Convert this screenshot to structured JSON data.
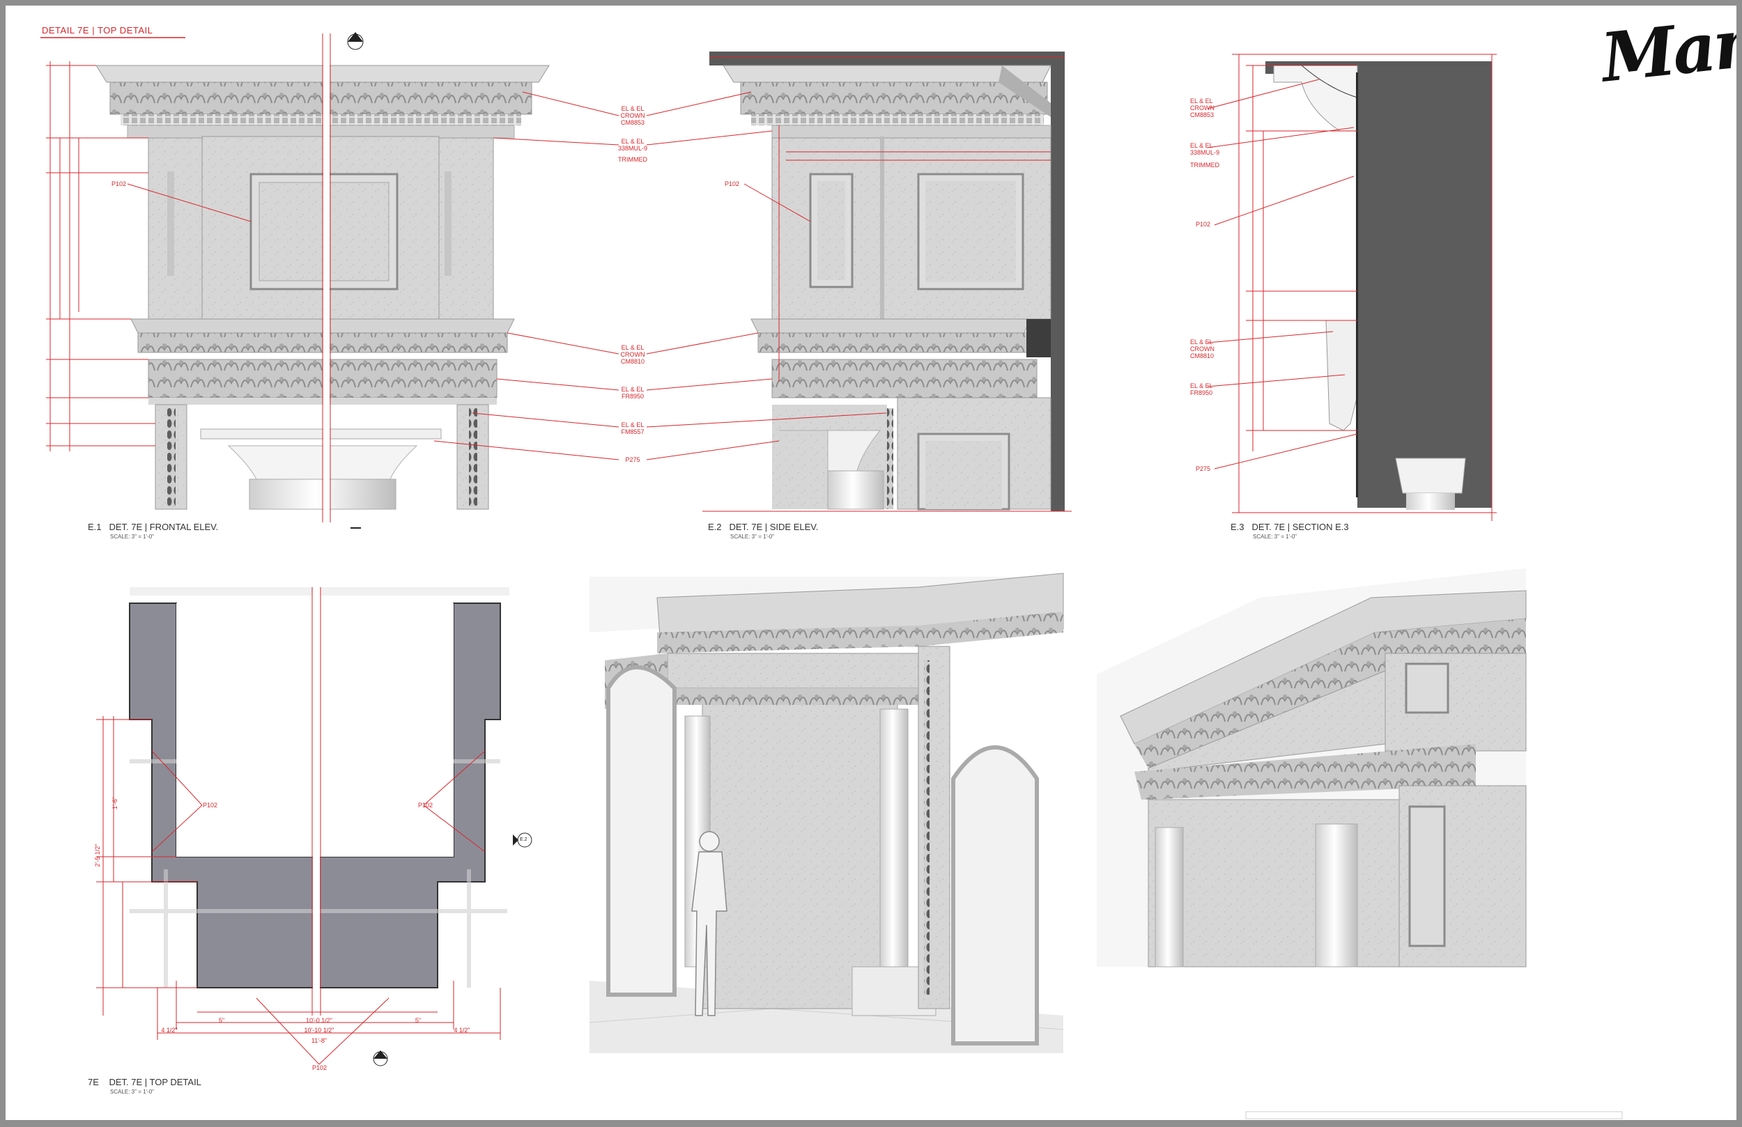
{
  "brand": {
    "logo_text": "Mank"
  },
  "sheet_header": {
    "text": "DETAIL 7E | TOP DETAIL"
  },
  "views": [
    {
      "num": "E.1",
      "title": "DET. 7E | FRONTAL ELEV.",
      "scale": "SCALE: 3\" = 1'-0\""
    },
    {
      "num": "E.2",
      "title": "DET. 7E | SIDE ELEV.",
      "scale": "SCALE: 3\" = 1'-0\""
    },
    {
      "num": "E.3",
      "title": "DET. 7E | SECTION E.3",
      "scale": "SCALE: 3\" = 1'-0\""
    },
    {
      "num": "7E",
      "title": "DET. 7E | TOP DETAIL",
      "scale": "SCALE: 3\" = 1'-0\""
    }
  ],
  "callouts_e1e2": [
    {
      "lines": [
        "EL & EL",
        "CROWN",
        "CM8853"
      ]
    },
    {
      "lines": [
        "EL & EL",
        "338MUL-9"
      ]
    },
    {
      "lines": [
        "TRIMMED"
      ]
    },
    {
      "lines": [
        "EL & EL",
        "CROWN",
        "CM8810"
      ]
    },
    {
      "lines": [
        "EL & EL",
        "FR8950"
      ]
    },
    {
      "lines": [
        "EL & EL",
        "FM8557"
      ]
    },
    {
      "lines": [
        "P275"
      ]
    }
  ],
  "material_tag": "P102",
  "callouts_e3": [
    {
      "lines": [
        "EL & EL",
        "CROWN",
        "CM8853"
      ]
    },
    {
      "lines": [
        "EL & EL",
        "338MUL-9"
      ]
    },
    {
      "lines": [
        "TRIMMED"
      ]
    },
    {
      "lines": [
        "P102"
      ]
    },
    {
      "lines": [
        "EL & EL",
        "CROWN",
        "CM8810"
      ]
    },
    {
      "lines": [
        "EL & EL",
        "FR8950"
      ]
    },
    {
      "lines": [
        "P275"
      ]
    }
  ],
  "plan_dims": {
    "overall": "11'-8\"",
    "inner": "10'-10 1/2\"",
    "inner2": "10'-0 1/2\"",
    "side_a": "4 1/2\"",
    "side_b": "4 1/2\"",
    "return_a": "5\"",
    "return_b": "5\"",
    "depth": "2'-5 1/2\"",
    "flank": "1'-6\""
  },
  "section_markers": {
    "e3": "E.3",
    "e2": "E.2"
  },
  "colors": {
    "accent": "#d9262b",
    "section_fill": "#5e5e5e",
    "plan_fill": "#8d8d96",
    "stone": "#d7d7d7"
  }
}
